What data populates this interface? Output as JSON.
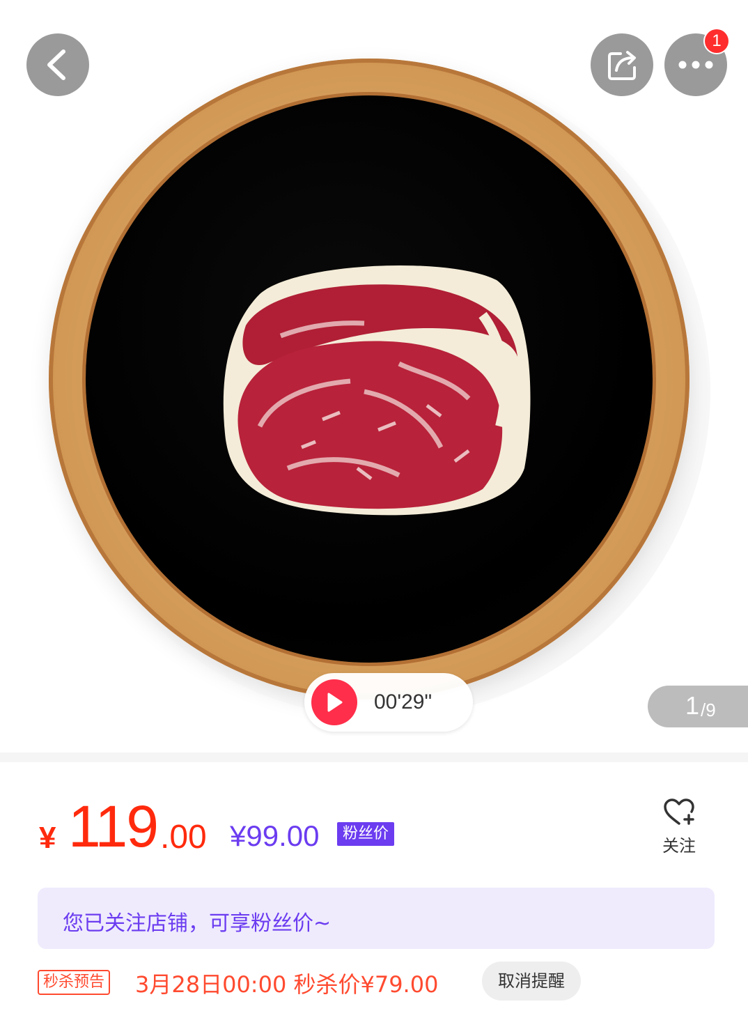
{
  "gallery": {
    "badge_count": "1",
    "video_duration": "00'29\"",
    "page_current": "1",
    "page_total": "/9",
    "icons": {
      "back": "chevron-left-icon",
      "share": "share-icon",
      "more": "more-dots-icon",
      "play": "play-icon"
    }
  },
  "price": {
    "currency": "¥",
    "integer": "119",
    "decimal": ".00",
    "fans_price": "¥99.00",
    "fans_tag": "粉丝价"
  },
  "follow": {
    "label": "关注",
    "icon": "heart-plus-icon"
  },
  "notice": {
    "text": "您已关注店铺，可享粉丝价~"
  },
  "flash_sale": {
    "tag": "秒杀预告",
    "text": "3月28日00:00 秒杀价¥79.00",
    "cancel_label": "取消提醒"
  },
  "colors": {
    "price_red": "#ff2a0d",
    "fans_purple": "#6b3cf0",
    "notice_bg": "#efebfd",
    "play_red": "#ff2e4a",
    "badge_red": "#ff2d2d"
  }
}
